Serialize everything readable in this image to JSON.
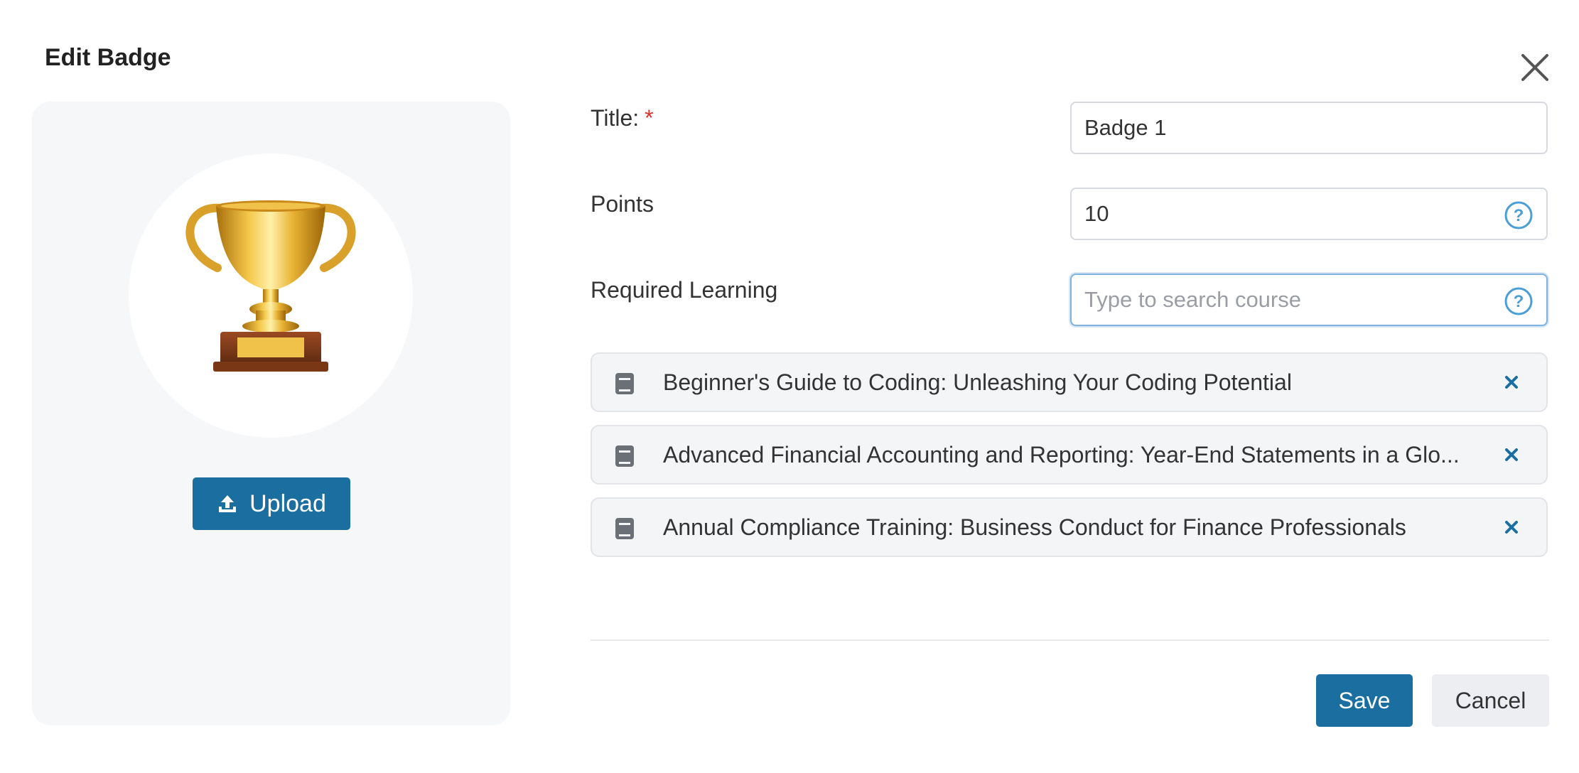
{
  "dialog": {
    "title": "Edit Badge",
    "close_icon": "close-icon"
  },
  "image_panel": {
    "image": "trophy-image",
    "upload_icon": "upload-icon",
    "upload_label": "Upload"
  },
  "form": {
    "title": {
      "label": "Title:",
      "required_mark": "*",
      "value": "Badge 1"
    },
    "points": {
      "label": "Points",
      "value": "10",
      "help_icon": "question-circle-icon"
    },
    "required_learning": {
      "label": "Required Learning",
      "placeholder": "Type to search course",
      "help_icon": "question-circle-icon"
    },
    "courses": [
      {
        "title": "Beginner's Guide to Coding: Unleashing Your Coding Potential",
        "icon": "book-icon",
        "remove_icon": "remove-x-icon"
      },
      {
        "title": "Advanced Financial Accounting and Reporting: Year-End Statements in a Glo...",
        "icon": "book-icon",
        "remove_icon": "remove-x-icon"
      },
      {
        "title": "Annual Compliance Training: Business Conduct for Finance Professionals",
        "icon": "book-icon",
        "remove_icon": "remove-x-icon"
      }
    ]
  },
  "footer": {
    "save_label": "Save",
    "cancel_label": "Cancel"
  },
  "colors": {
    "primary": "#1a6fa0",
    "required": "#d9322b",
    "focus_border": "#7fb3de",
    "help_icon": "#4a9fd5",
    "panel_bg": "#f6f7f9"
  }
}
